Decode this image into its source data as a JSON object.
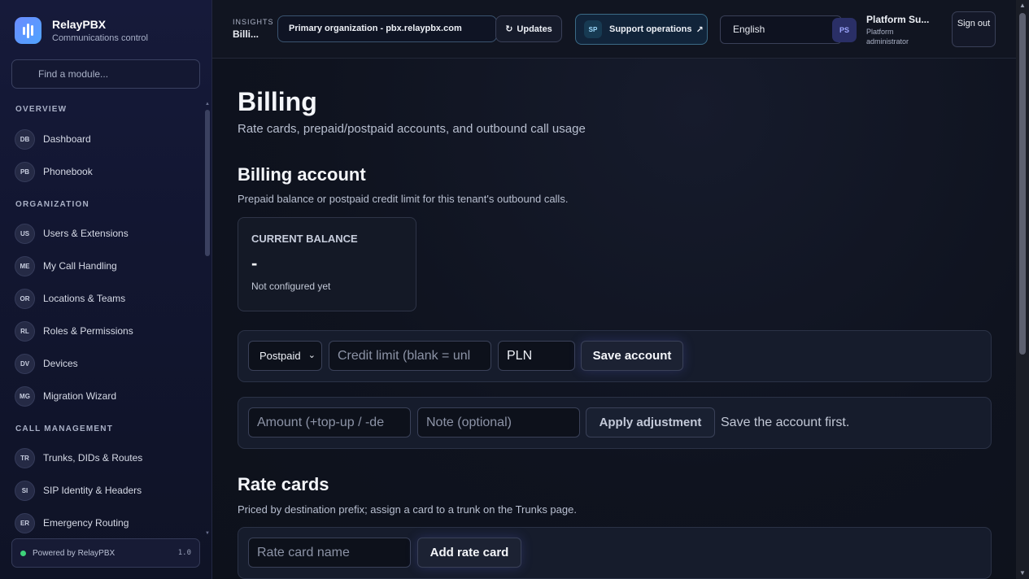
{
  "brand": {
    "name": "RelayPBX",
    "subtitle": "Communications control"
  },
  "sidebar": {
    "search_placeholder": "Find a module...",
    "sections": [
      {
        "title": "OVERVIEW",
        "items": [
          {
            "badge": "DB",
            "label": "Dashboard"
          },
          {
            "badge": "PB",
            "label": "Phonebook"
          }
        ]
      },
      {
        "title": "ORGANIZATION",
        "items": [
          {
            "badge": "US",
            "label": "Users & Extensions"
          },
          {
            "badge": "ME",
            "label": "My Call Handling"
          },
          {
            "badge": "OR",
            "label": "Locations & Teams"
          },
          {
            "badge": "RL",
            "label": "Roles & Permissions"
          },
          {
            "badge": "DV",
            "label": "Devices"
          },
          {
            "badge": "MG",
            "label": "Migration Wizard"
          }
        ]
      },
      {
        "title": "CALL MANAGEMENT",
        "items": [
          {
            "badge": "TR",
            "label": "Trunks, DIDs & Routes"
          },
          {
            "badge": "SI",
            "label": "SIP Identity & Headers"
          },
          {
            "badge": "ER",
            "label": "Emergency Routing"
          }
        ]
      }
    ],
    "powered_by": "Powered by RelayPBX",
    "version": "1.0"
  },
  "topbar": {
    "kicker": "INSIGHTS",
    "title": "Billi...",
    "org_select": "Primary organization - pbx.relaypbx.com",
    "updates_label": "Updates",
    "support": {
      "badge": "SP",
      "label": "Support operations"
    },
    "language": "English",
    "user": {
      "initials": "PS",
      "name": "Platform Su...",
      "role": "Platform administrator"
    },
    "signout_label": "Sign out"
  },
  "main": {
    "title": "Billing",
    "subtitle": "Rate cards, prepaid/postpaid accounts, and outbound call usage",
    "billing_account": {
      "title": "Billing account",
      "subtitle": "Prepaid balance or postpaid credit limit for this tenant's outbound calls.",
      "balance_label": "CURRENT BALANCE",
      "balance_value": "-",
      "balance_note": "Not configured yet",
      "mode_select": "Postpaid",
      "credit_placeholder": "Credit limit (blank = unl",
      "currency_value": "PLN",
      "save_label": "Save account",
      "amount_placeholder": "Amount (+top-up / -de",
      "note_placeholder": "Note (optional)",
      "apply_label": "Apply adjustment",
      "apply_hint": "Save the account first."
    },
    "rate_cards": {
      "title": "Rate cards",
      "subtitle": "Priced by destination prefix; assign a card to a trunk on the Trunks page.",
      "name_placeholder": "Rate card name",
      "add_label": "Add rate card"
    }
  }
}
